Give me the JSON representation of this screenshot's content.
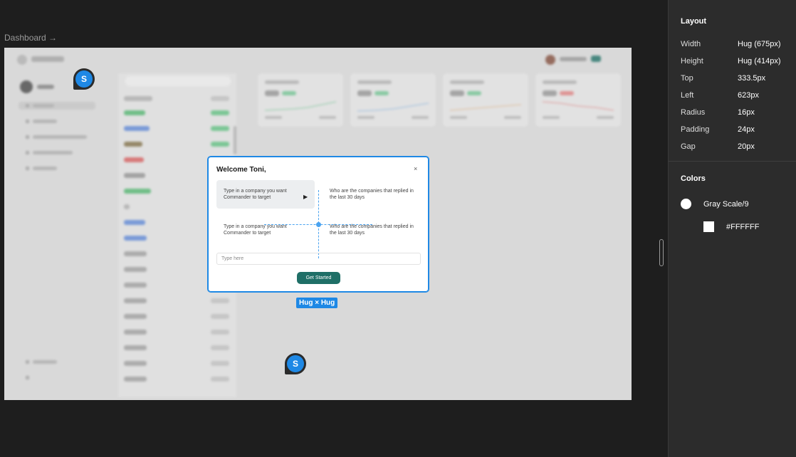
{
  "canvas": {
    "frame_label": "Dashboard →"
  },
  "modal": {
    "title": "Welcome Toni,",
    "close_label": "×",
    "options": [
      "Type in a company you want Commander to target",
      "Who are the companies that replied in the last 30 days",
      "Type in a company you want Commander to target",
      "Who are the companies that replied in the last 30 days"
    ],
    "input_placeholder": "Type here",
    "button_label": "Get Started"
  },
  "selection_tag": "Hug × Hug",
  "pins": {
    "letter": "S"
  },
  "panel": {
    "layout_heading": "Layout",
    "layout_props": [
      {
        "key": "Width",
        "value": "Hug (675px)"
      },
      {
        "key": "Height",
        "value": "Hug (414px)"
      },
      {
        "key": "Top",
        "value": "333.5px"
      },
      {
        "key": "Left",
        "value": "623px"
      },
      {
        "key": "Radius",
        "value": "16px"
      },
      {
        "key": "Padding",
        "value": "24px"
      },
      {
        "key": "Gap",
        "value": "20px"
      }
    ],
    "colors_heading": "Colors",
    "colors": [
      {
        "name": "Gray Scale/9",
        "hex": "#FFFFFF"
      },
      {
        "name": "#FFFFFF",
        "hex": "#FFFFFF"
      }
    ]
  },
  "theme": {
    "accent": "#1e88e5",
    "button": "#1f6f67",
    "background": "#1e1e1e",
    "panel": "#2c2c2c"
  }
}
